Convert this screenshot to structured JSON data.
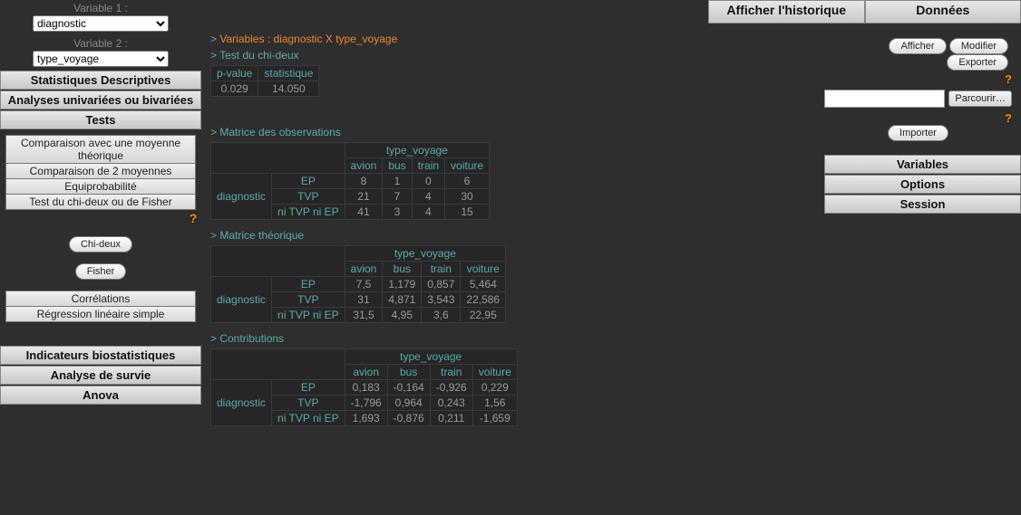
{
  "left": {
    "var1_label": "Variable 1 :",
    "var1_value": "diagnostic",
    "var2_label": "Variable 2 :",
    "var2_value": "type_voyage",
    "sections": {
      "stats_desc": "Statistiques Descriptives",
      "analyses": "Analyses univariées ou bivariées",
      "tests": "Tests",
      "indic": "Indicateurs biostatistiques",
      "survie": "Analyse de survie",
      "anova": "Anova"
    },
    "tests_items": {
      "comp_theo": "Comparaison avec une moyenne théorique",
      "comp2": "Comparaison de 2 moyennes",
      "equi": "Equiprobabilité",
      "chi_fisher": "Test du chi-deux ou de Fisher"
    },
    "chi_btn": "Chi-deux",
    "fisher_btn": "Fisher",
    "correl": "Corrélations",
    "regress": "Régression linéaire simple"
  },
  "top": {
    "historique": "Afficher l'historique",
    "donnees": "Données"
  },
  "right": {
    "afficher": "Afficher",
    "modifier": "Modifier",
    "exporter": "Exporter",
    "parcourir": "Parcourir…",
    "importer": "Importer",
    "variables": "Variables",
    "options": "Options",
    "session": "Session"
  },
  "main": {
    "vars_title": "Variables : diagnostic X type_voyage",
    "test_title": "Test du chi-deux",
    "pvalue_h": "p-value",
    "stat_h": "statistique",
    "pvalue": "0.029",
    "stat": "14.050",
    "obs_title": "Matrice des observations",
    "theo_title": "Matrice théorique",
    "contrib_title": "Contributions",
    "col_var": "type_voyage",
    "row_var": "diagnostic",
    "cols": {
      "c0": "avion",
      "c1": "bus",
      "c2": "train",
      "c3": "voiture"
    },
    "rows": {
      "r0": "EP",
      "r1": "TVP",
      "r2": "ni TVP ni EP"
    },
    "obs": {
      "r0c0": "8",
      "r0c1": "1",
      "r0c2": "0",
      "r0c3": "6",
      "r1c0": "21",
      "r1c1": "7",
      "r1c2": "4",
      "r1c3": "30",
      "r2c0": "41",
      "r2c1": "3",
      "r2c2": "4",
      "r2c3": "15"
    },
    "theo": {
      "r0c0": "7,5",
      "r0c1": "1,179",
      "r0c2": "0,857",
      "r0c3": "5,464",
      "r1c0": "31",
      "r1c1": "4,871",
      "r1c2": "3,543",
      "r1c3": "22,586",
      "r2c0": "31,5",
      "r2c1": "4,95",
      "r2c2": "3,6",
      "r2c3": "22,95"
    },
    "contrib": {
      "r0c0": "0,183",
      "r0c1": "-0,164",
      "r0c2": "-0,926",
      "r0c3": "0,229",
      "r1c0": "-1,796",
      "r1c1": "0,964",
      "r1c2": "0,243",
      "r1c3": "1,56",
      "r2c0": "1,693",
      "r2c1": "-0,876",
      "r2c2": "0,211",
      "r2c3": "-1,659"
    }
  }
}
